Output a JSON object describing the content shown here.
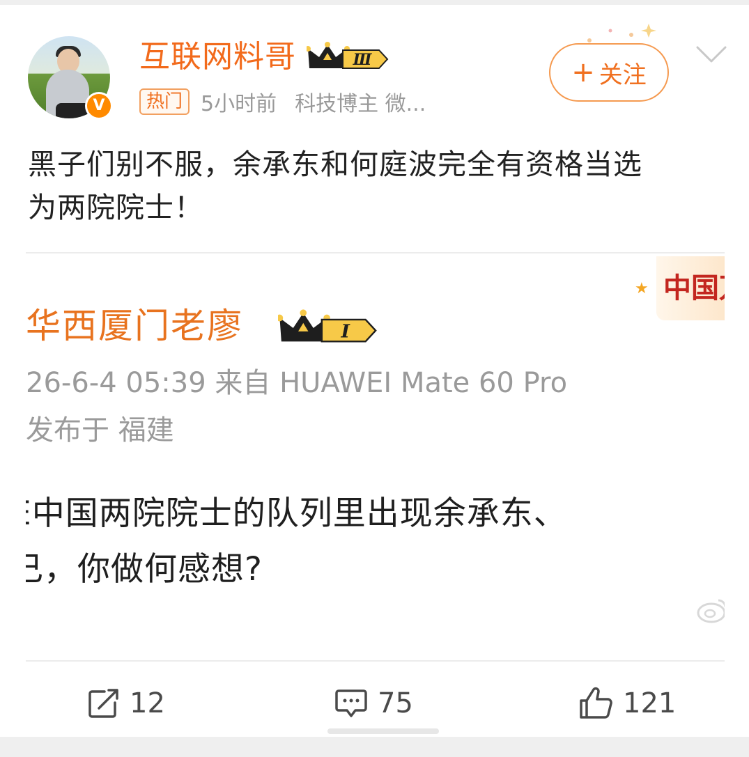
{
  "post": {
    "author": "互联网料哥",
    "author_level": "Ⅲ",
    "tag_hot": "热门",
    "time": "5小时前",
    "identity": "科技博主 微...",
    "follow_label": "关注",
    "text_line1": "黑子们别不服，余承东和何庭波完全有资格当选",
    "text_line2": "为两院院士！"
  },
  "quoted": {
    "banner": "中国万",
    "author": "华西厦门老廖",
    "author_level": "I",
    "meta_line1": "26-6-4 05:39  来自 HUAWEI Mate 60 Pro",
    "meta_line2": "发布于 福建",
    "body_line1": "E中国两院院士的队列里出现余承东、",
    "body_line2": "己，你做何感想?"
  },
  "actions": {
    "repost_count": "12",
    "comment_count": "75",
    "like_count": "121"
  },
  "colors": {
    "accent_orange": "#f26a1b",
    "gray_text": "#999999"
  },
  "icons": [
    "verified-icon",
    "crown-icon",
    "chevron-down-icon",
    "repost-icon",
    "comment-icon",
    "like-icon"
  ]
}
